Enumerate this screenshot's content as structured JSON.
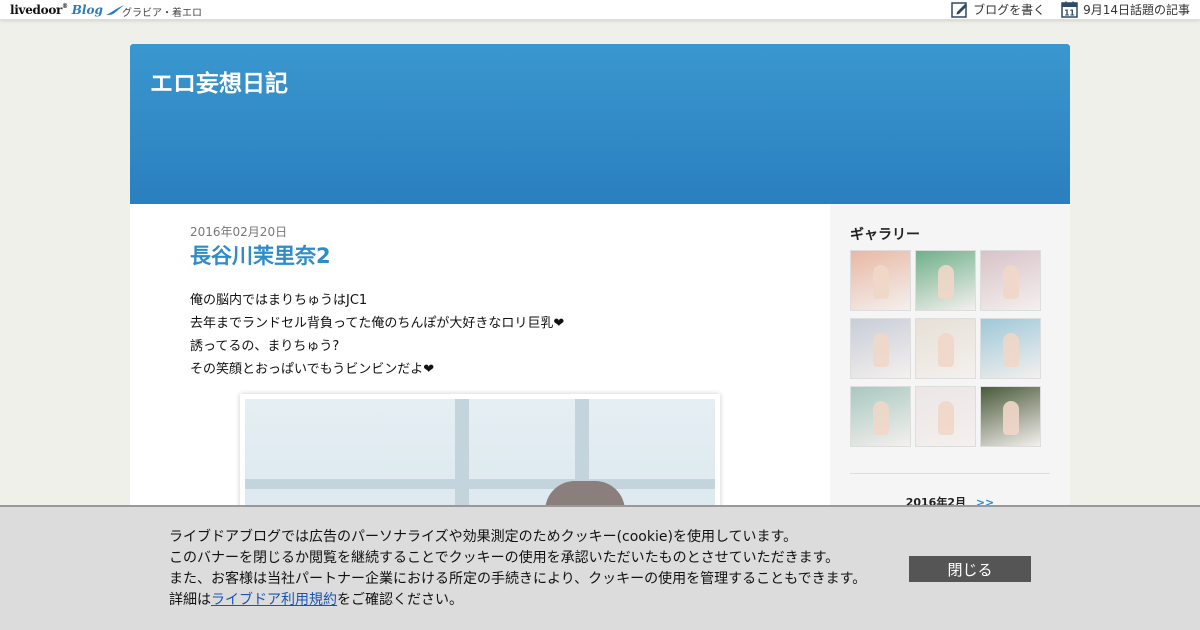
{
  "topbar": {
    "logo_text": "livedoor",
    "logo_sup": "®",
    "logo_blog": "Blog",
    "category": "グラビア・着エロ",
    "write_label": "ブログを書く",
    "calendar_day": "11",
    "trending_label": "9月14日話題の記事"
  },
  "blog": {
    "title": "エロ妄想日記"
  },
  "post": {
    "date": "2016年02月20日",
    "title": "長谷川茉里奈2",
    "lines": [
      "俺の脳内ではまりちゅうはJC1",
      "去年までランドセル背負ってた俺のちんぽが大好きなロリ巨乳❤",
      "誘ってるの、まりちゅう?",
      "その笑顔とおっぱいでもうビンビンだよ❤"
    ]
  },
  "sidebar": {
    "gallery_title": "ギャラリー",
    "thumbs": [
      {
        "color": "#e8b8a4"
      },
      {
        "color": "#6fb08a"
      },
      {
        "color": "#d8c2c8"
      },
      {
        "color": "#c8cdd8"
      },
      {
        "color": "#e6e0d6"
      },
      {
        "color": "#9ec8d8"
      },
      {
        "color": "#a8c8c0"
      },
      {
        "color": "#ece6e6"
      },
      {
        "color": "#4a5a3a"
      }
    ],
    "calendar_month": "2016年2月",
    "calendar_next": ">>"
  },
  "cookie": {
    "line1": "ライブドアブログでは広告のパーソナライズや効果測定のためクッキー(cookie)を使用しています。",
    "line2": "このバナーを閉じるか閲覧を継続することでクッキーの使用を承認いただいたものとさせていただきます。",
    "line3": "また、お客様は当社パートナー企業における所定の手続きにより、クッキーの使用を管理することもできます。",
    "line4_prefix": "詳細は",
    "line4_link": "ライブドア利用規約",
    "line4_suffix": "をご確認ください。",
    "close_label": "閉じる"
  },
  "colors": {
    "header_blue": "#2a7fbf",
    "title_blue": "#2e8cc8",
    "close_btn": "#555555"
  }
}
